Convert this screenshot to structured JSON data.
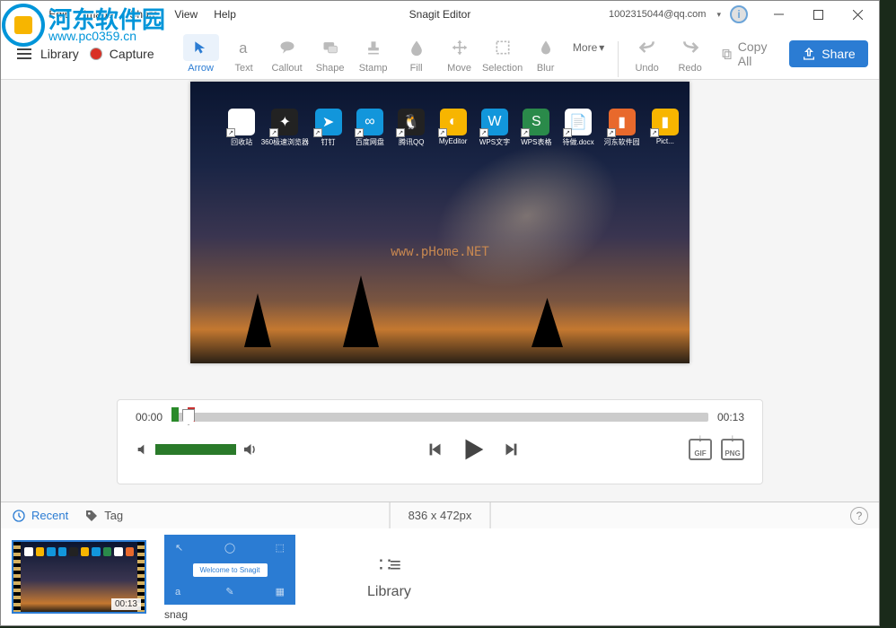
{
  "watermark": {
    "text": "河东软件园",
    "url": "www.pc0359.cn"
  },
  "menu": {
    "file": "File",
    "edit": "Edit",
    "image": "Image",
    "share": "Share",
    "view": "View",
    "help": "Help"
  },
  "title": "Snagit Editor",
  "account": "1002315044@qq.com",
  "titlebar": {
    "dropdown_glyph": "▾"
  },
  "toolbar": {
    "library": "Library",
    "capture": "Capture",
    "arrow": "Arrow",
    "text": "Text",
    "callout": "Callout",
    "shape": "Shape",
    "stamp": "Stamp",
    "fill": "Fill",
    "move": "Move",
    "selection": "Selection",
    "blur": "Blur",
    "more": "More",
    "undo": "Undo",
    "redo": "Redo",
    "copyall": "Copy All",
    "share": "Share"
  },
  "canvas": {
    "watermark": "www.pHome.NET",
    "icons": [
      {
        "label": "回收站",
        "color": "#ffffff",
        "glyph": "🗑"
      },
      {
        "label": "360极速浏览器",
        "color": "#222",
        "glyph": "✦"
      },
      {
        "label": "钉钉",
        "color": "#1296db",
        "glyph": "➤"
      },
      {
        "label": "百度网盘",
        "color": "#1296db",
        "glyph": "∞"
      },
      {
        "label": "腾讯QQ",
        "color": "#222",
        "glyph": "🐧"
      },
      {
        "label": "MyEditor",
        "color": "#f7b500",
        "glyph": "◐"
      },
      {
        "label": "WPS文字",
        "color": "#1296db",
        "glyph": "W"
      },
      {
        "label": "WPS表格",
        "color": "#2a8a4a",
        "glyph": "S"
      },
      {
        "label": "待做.docx",
        "color": "#fff",
        "glyph": "📄"
      },
      {
        "label": "河东软件园",
        "color": "#e8692c",
        "glyph": "▮"
      },
      {
        "label": "Pict...",
        "color": "#f7b500",
        "glyph": "▮"
      }
    ]
  },
  "player": {
    "current": "00:00",
    "total": "00:13",
    "gif": "GIF",
    "png": "PNG"
  },
  "tray": {
    "recent": "Recent",
    "tag": "Tag",
    "dimensions": "836 x 472px",
    "library": "Library",
    "help_glyph": "?",
    "thumb1_time": "00:13",
    "thumb2_label": "snag",
    "thumb2_banner": "Welcome to Snagit"
  }
}
